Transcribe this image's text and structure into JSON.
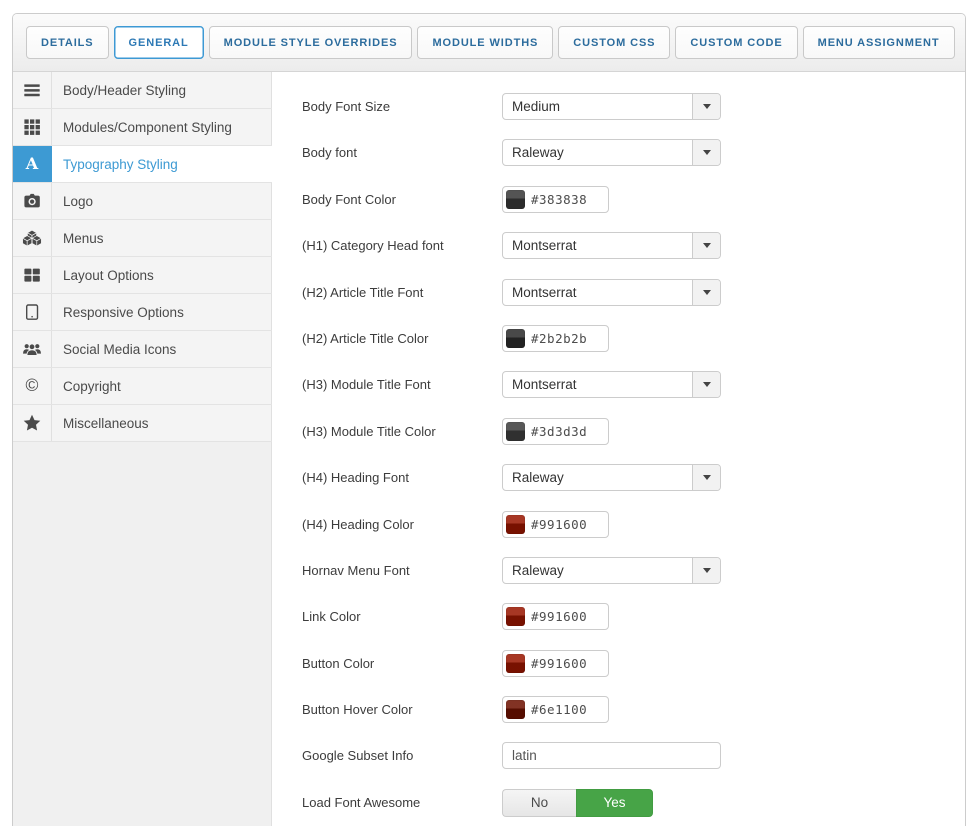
{
  "tabs": {
    "items": [
      {
        "label": "DETAILS",
        "active": false
      },
      {
        "label": "GENERAL",
        "active": true
      },
      {
        "label": "MODULE STYLE OVERRIDES",
        "active": false
      },
      {
        "label": "MODULE WIDTHS",
        "active": false
      },
      {
        "label": "CUSTOM CSS",
        "active": false
      },
      {
        "label": "CUSTOM CODE",
        "active": false
      },
      {
        "label": "MENU ASSIGNMENT",
        "active": false
      }
    ]
  },
  "sidebar": {
    "items": [
      {
        "label": "Body/Header Styling",
        "icon": "bars-icon",
        "active": false
      },
      {
        "label": "Modules/Component Styling",
        "icon": "th-grid-icon",
        "active": false
      },
      {
        "label": "Typography Styling",
        "icon": "font-icon",
        "active": true
      },
      {
        "label": "Logo",
        "icon": "camera-icon",
        "active": false
      },
      {
        "label": "Menus",
        "icon": "cubes-icon",
        "active": false
      },
      {
        "label": "Layout Options",
        "icon": "th-large-icon",
        "active": false
      },
      {
        "label": "Responsive Options",
        "icon": "tablet-icon",
        "active": false
      },
      {
        "label": "Social Media Icons",
        "icon": "users-icon",
        "active": false
      },
      {
        "label": "Copyright",
        "icon": "copyright-icon",
        "active": false
      },
      {
        "label": "Miscellaneous",
        "icon": "star-icon",
        "active": false
      }
    ]
  },
  "form": {
    "rows": [
      {
        "type": "select",
        "label": "Body Font Size",
        "value": "Medium"
      },
      {
        "type": "select",
        "label": "Body font",
        "value": "Raleway"
      },
      {
        "type": "color",
        "label": "Body Font Color",
        "value": "#383838"
      },
      {
        "type": "select",
        "label": "(H1) Category Head font",
        "value": "Montserrat"
      },
      {
        "type": "select",
        "label": "(H2) Article Title Font",
        "value": "Montserrat"
      },
      {
        "type": "color",
        "label": "(H2) Article Title Color",
        "value": "#2b2b2b"
      },
      {
        "type": "select",
        "label": "(H3) Module Title Font",
        "value": "Montserrat"
      },
      {
        "type": "color",
        "label": "(H3) Module Title Color",
        "value": "#3d3d3d"
      },
      {
        "type": "select",
        "label": "(H4) Heading Font",
        "value": "Raleway"
      },
      {
        "type": "color",
        "label": "(H4) Heading Color",
        "value": "#991600"
      },
      {
        "type": "select",
        "label": "Hornav Menu Font",
        "value": "Raleway"
      },
      {
        "type": "color",
        "label": "Link Color",
        "value": "#991600"
      },
      {
        "type": "color",
        "label": "Button Color",
        "value": "#991600"
      },
      {
        "type": "color",
        "label": "Button Hover Color",
        "value": "#6e1100"
      },
      {
        "type": "text",
        "label": "Google Subset Info",
        "value": "latin"
      },
      {
        "type": "toggle",
        "label": "Load Font Awesome",
        "options": [
          "No",
          "Yes"
        ],
        "selected": "Yes"
      }
    ]
  },
  "colors": {
    "accent_blue": "#3d9ad3",
    "toggle_green": "#47a447",
    "tab_text": "#2c6c9d"
  }
}
